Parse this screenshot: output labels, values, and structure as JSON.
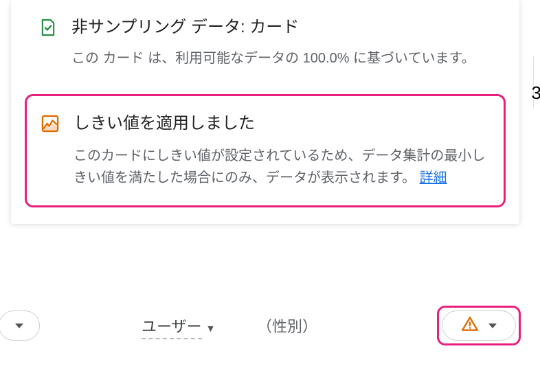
{
  "sampling": {
    "title": "非サンプリング データ: カード",
    "body": "この カード は、利用可能なデータの 100.0% に基づいています。"
  },
  "threshold": {
    "title": "しきい値を適用しました",
    "body": "このカードにしきい値が設定されているため、データ集計の最小しきい値を満たした場合にのみ、データが表示されます。",
    "link_label": "詳細"
  },
  "dropdown": {
    "metric": "ユーザー",
    "dimension": "（性別）"
  },
  "stray": {
    "three": "3"
  }
}
